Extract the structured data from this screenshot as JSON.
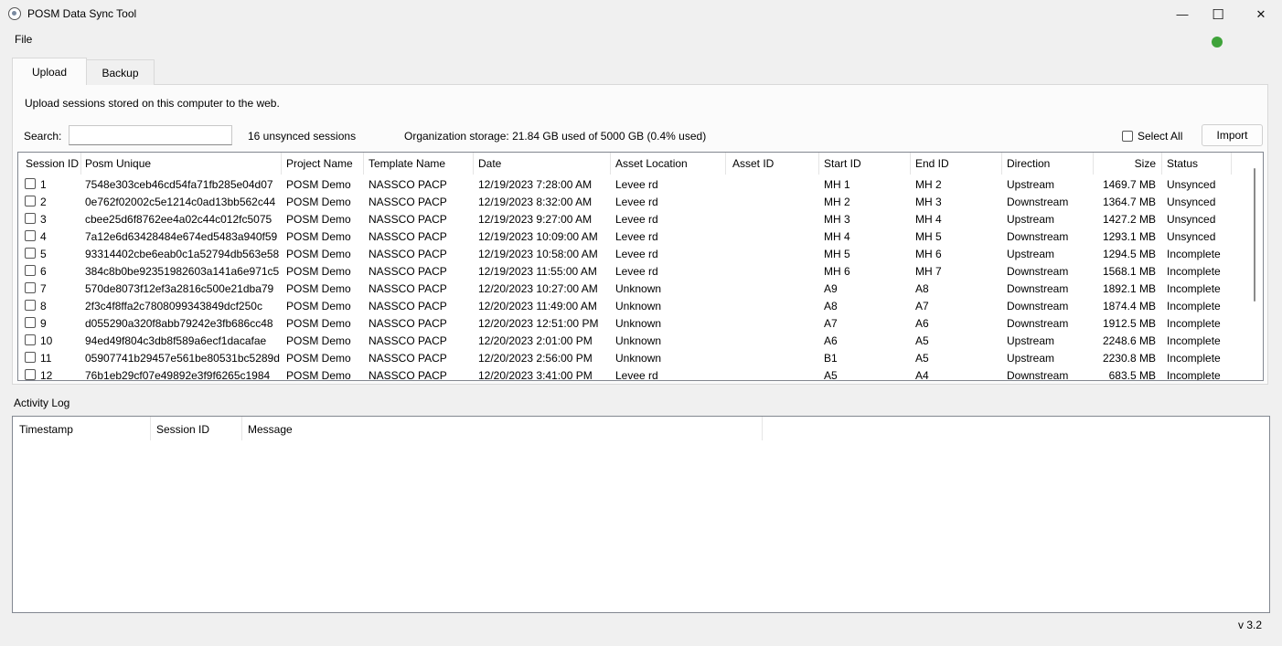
{
  "window": {
    "title": "POSM Data Sync Tool",
    "minimize_glyph": "—",
    "maximize_glyph": "☐",
    "close_glyph": "✕",
    "status_color": "#3fa33a"
  },
  "menu": {
    "file": "File"
  },
  "tabs": {
    "upload": "Upload",
    "backup": "Backup"
  },
  "upload": {
    "description": "Upload sessions stored on this computer to the web.",
    "search_label": "Search:",
    "search_value": "",
    "unsynced_count": "16 unsynced sessions",
    "storage": "Organization storage: 21.84 GB used of 5000 GB (0.4% used)",
    "select_all": "Select All",
    "import": "Import"
  },
  "sessions": {
    "columns": [
      "Session ID",
      "Posm Unique",
      "Project Name",
      "Template Name",
      "Date",
      "Asset Location",
      "Asset ID",
      "Start ID",
      "End ID",
      "Direction",
      "Size",
      "Status"
    ],
    "rows": [
      [
        "1",
        "7548e303ceb46cd54fa71fb285e04d07",
        "POSM Demo",
        "NASSCO PACP",
        "12/19/2023 7:28:00 AM",
        "Levee rd",
        "",
        "MH 1",
        "MH 2",
        "Upstream",
        "1469.7 MB",
        "Unsynced"
      ],
      [
        "2",
        "0e762f02002c5e1214c0ad13bb562c44",
        "POSM Demo",
        "NASSCO PACP",
        "12/19/2023 8:32:00 AM",
        "Levee rd",
        "",
        "MH 2",
        "MH 3",
        "Downstream",
        "1364.7 MB",
        "Unsynced"
      ],
      [
        "3",
        "cbee25d6f8762ee4a02c44c012fc5075",
        "POSM Demo",
        "NASSCO PACP",
        "12/19/2023 9:27:00 AM",
        "Levee rd",
        "",
        "MH 3",
        "MH 4",
        "Upstream",
        "1427.2 MB",
        "Unsynced"
      ],
      [
        "4",
        "7a12e6d63428484e674ed5483a940f59",
        "POSM Demo",
        "NASSCO PACP",
        "12/19/2023 10:09:00 AM",
        "Levee rd",
        "",
        "MH 4",
        "MH 5",
        "Downstream",
        "1293.1 MB",
        "Unsynced"
      ],
      [
        "5",
        "93314402cbe6eab0c1a52794db563e58",
        "POSM Demo",
        "NASSCO PACP",
        "12/19/2023 10:58:00 AM",
        "Levee rd",
        "",
        "MH 5",
        "MH 6",
        "Upstream",
        "1294.5 MB",
        "Incomplete"
      ],
      [
        "6",
        "384c8b0be92351982603a141a6e971c5",
        "POSM Demo",
        "NASSCO PACP",
        "12/19/2023 11:55:00 AM",
        "Levee rd",
        "",
        "MH 6",
        "MH 7",
        "Downstream",
        "1568.1 MB",
        "Incomplete"
      ],
      [
        "7",
        "570de8073f12ef3a2816c500e21dba79",
        "POSM Demo",
        "NASSCO PACP",
        "12/20/2023 10:27:00 AM",
        "Unknown",
        "",
        "A9",
        "A8",
        "Downstream",
        "1892.1 MB",
        "Incomplete"
      ],
      [
        "8",
        "2f3c4f8ffa2c7808099343849dcf250c",
        "POSM Demo",
        "NASSCO PACP",
        "12/20/2023 11:49:00 AM",
        "Unknown",
        "",
        "A8",
        "A7",
        "Downstream",
        "1874.4 MB",
        "Incomplete"
      ],
      [
        "9",
        "d055290a320f8abb79242e3fb686cc48",
        "POSM Demo",
        "NASSCO PACP",
        "12/20/2023 12:51:00 PM",
        "Unknown",
        "",
        "A7",
        "A6",
        "Downstream",
        "1912.5 MB",
        "Incomplete"
      ],
      [
        "10",
        "94ed49f804c3db8f589a6ecf1dacafae",
        "POSM Demo",
        "NASSCO PACP",
        "12/20/2023 2:01:00 PM",
        "Unknown",
        "",
        "A6",
        "A5",
        "Upstream",
        "2248.6 MB",
        "Incomplete"
      ],
      [
        "11",
        "05907741b29457e561be80531bc5289d",
        "POSM Demo",
        "NASSCO PACP",
        "12/20/2023 2:56:00 PM",
        "Unknown",
        "",
        "B1",
        "A5",
        "Upstream",
        "2230.8 MB",
        "Incomplete"
      ],
      [
        "12",
        "76b1eb29cf07e49892e3f9f6265c1984",
        "POSM Demo",
        "NASSCO PACP",
        "12/20/2023 3:41:00 PM",
        "Levee rd",
        "",
        "A5",
        "A4",
        "Downstream",
        "683.5 MB",
        "Incomplete"
      ]
    ]
  },
  "activity_log": {
    "label": "Activity Log",
    "columns": [
      "Timestamp",
      "Session ID",
      "Message"
    ]
  },
  "footer": {
    "version": "v 3.2"
  }
}
